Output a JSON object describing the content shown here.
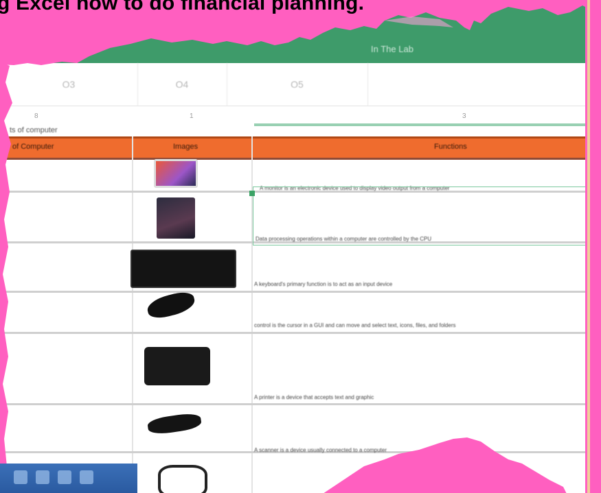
{
  "title": "g Excel how to do financial planning.",
  "ribbon": {
    "label": "In The Lab"
  },
  "columns": {
    "c1": "O3",
    "c2": "O4",
    "c3": "O5"
  },
  "index_row": {
    "a": "8",
    "b": "1",
    "c": "3"
  },
  "sheet_caption": "ts of computer",
  "table_header": {
    "parts": "of Computer",
    "images": "Images",
    "functions": "Functions"
  },
  "rows": [
    {
      "function": "A monitor is an electronic device used to display video output from a computer"
    },
    {
      "function": "Data processing operations within a computer are controlled by the CPU"
    },
    {
      "function": "A keyboard's primary function is to act as an input device"
    },
    {
      "function": "control is the cursor in a GUI and can move and select text, icons, files, and folders"
    },
    {
      "function": "A printer is a device that accepts text and graphic"
    },
    {
      "function": "A scanner is a device usually connected to a computer"
    }
  ],
  "colors": {
    "ribbon": "#3e9b6a",
    "header": "#ef6c2e",
    "pink": "#ff5fc0"
  }
}
